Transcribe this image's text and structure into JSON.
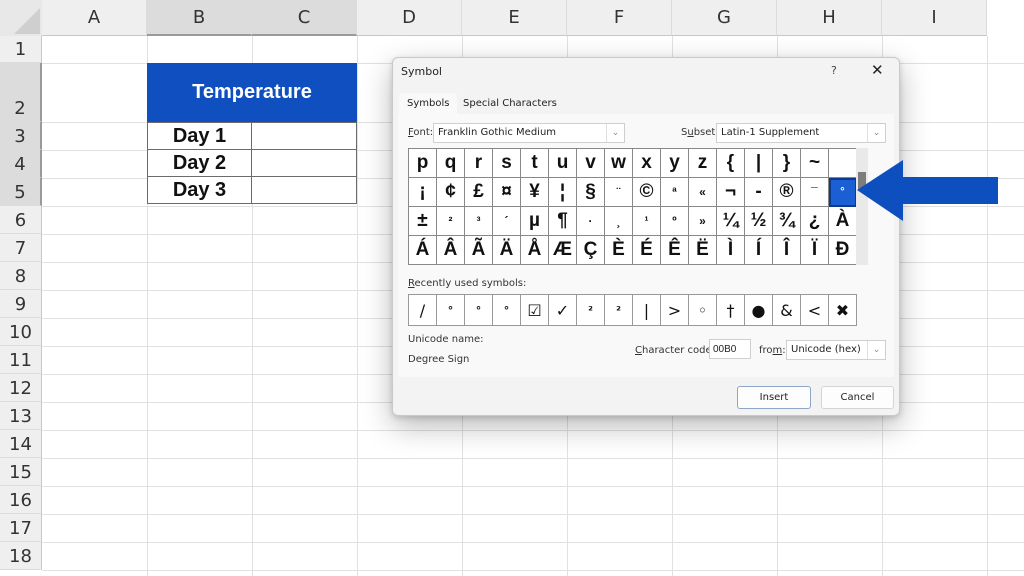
{
  "spreadsheet": {
    "columns": [
      "A",
      "B",
      "C",
      "D",
      "E",
      "F",
      "G",
      "H",
      "I"
    ],
    "rows": [
      "1",
      "2",
      "3",
      "4",
      "5",
      "6",
      "7",
      "8",
      "9",
      "10",
      "11",
      "12",
      "13",
      "14",
      "15",
      "16",
      "17",
      "18"
    ],
    "header_cell": "Temperature",
    "day_labels": [
      "Day 1",
      "Day 2",
      "Day 3"
    ],
    "header_color": "#0f4fc0"
  },
  "dialog": {
    "title": "Symbol",
    "help": "?",
    "close": "✕",
    "tabs": [
      {
        "label": "Symbols",
        "mnemonic": "y",
        "active": true
      },
      {
        "label": "Special Characters",
        "active": false
      }
    ],
    "font_label_pre": "",
    "font_label_u": "F",
    "font_label_post": "ont:",
    "font_value": "Franklin Gothic Medium",
    "subset_label_pre": "S",
    "subset_label_u": "u",
    "subset_label_post": "bset:",
    "subset_value": "Latin-1 Supplement",
    "symbols": [
      "p",
      "q",
      "r",
      "s",
      "t",
      "u",
      "v",
      "w",
      "x",
      "y",
      "z",
      "{",
      "|",
      "}",
      "~",
      "",
      "¡",
      "¢",
      "£",
      "¤",
      "¥",
      "¦",
      "§",
      "¨",
      "©",
      "ª",
      "«",
      "¬",
      "-",
      "®",
      "¯",
      "°",
      "±",
      "²",
      "³",
      "´",
      "µ",
      "¶",
      "·",
      "¸",
      "¹",
      "º",
      "»",
      "¼",
      "½",
      "¾",
      "¿",
      "À",
      "Á",
      "Â",
      "Ã",
      "Ä",
      "Å",
      "Æ",
      "Ç",
      "È",
      "É",
      "Ê",
      "Ë",
      "Ì",
      "Í",
      "Î",
      "Ï",
      "Ð"
    ],
    "selected_symbol": "°",
    "recent_label_u": "R",
    "recent_label_post": "ecently used symbols:",
    "recent_symbols": [
      "/",
      "°",
      "°",
      "°",
      "☑",
      "✓",
      "²",
      "²",
      "|",
      ">",
      "◦",
      "†",
      "●",
      "&",
      "<",
      "✖"
    ],
    "unicode_name_label": "Unicode name:",
    "unicode_name_value": "Degree Sign",
    "char_code_label_u": "C",
    "char_code_label_post": "haracter code:",
    "char_code_value": "00B0",
    "from_label_pre": "fro",
    "from_label_u": "m",
    "from_label_post": ":",
    "from_value": "Unicode (hex)",
    "insert_label": "Insert",
    "cancel_label": "Cancel",
    "chevron": "⌄"
  },
  "annotation": {
    "arrow_color": "#0d4fbf",
    "points_to": "Degree Sign"
  }
}
